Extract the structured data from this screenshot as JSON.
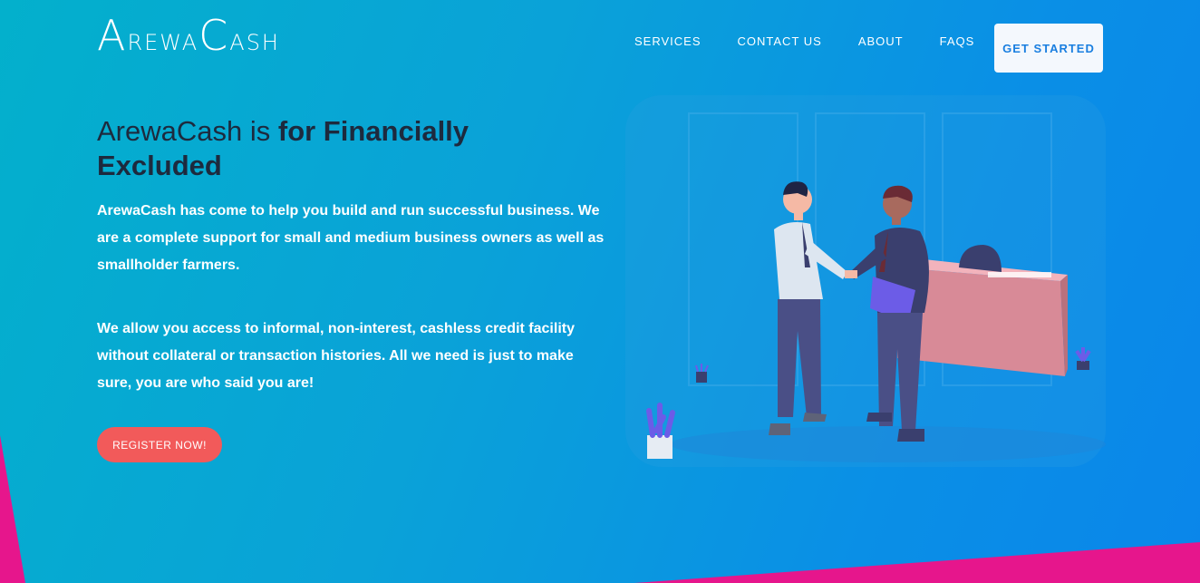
{
  "header": {
    "logo": {
      "part1_big": "A",
      "part1_small": "REWA",
      "part2_big": "C",
      "part2_small": "ASH"
    },
    "nav": [
      {
        "label": "SERVICES"
      },
      {
        "label": "CONTACT US"
      },
      {
        "label": "ABOUT"
      },
      {
        "label": "FAQS"
      }
    ],
    "cta_label": "GET STARTED"
  },
  "hero": {
    "title_light": "ArewaCash is",
    "title_bold": "for Financially Excluded",
    "paragraph1": "ArewaCash has come to help you build and run successful business. We are a complete support for small and medium business owners as well as smallholder farmers.",
    "paragraph2": "We allow you access to informal, non-interest, cashless credit facility without collateral or transaction histories. All we need is just to make sure, you are who said you are!",
    "register_label": "REGISTER NOW!"
  },
  "colors": {
    "gradient_start": "#03b0cc",
    "gradient_end": "#0a86ea",
    "accent_pink": "#e6168c",
    "register_button": "#f25a5a",
    "title_text": "#1d2a3e"
  },
  "icons": [
    "handshake-illustration"
  ]
}
